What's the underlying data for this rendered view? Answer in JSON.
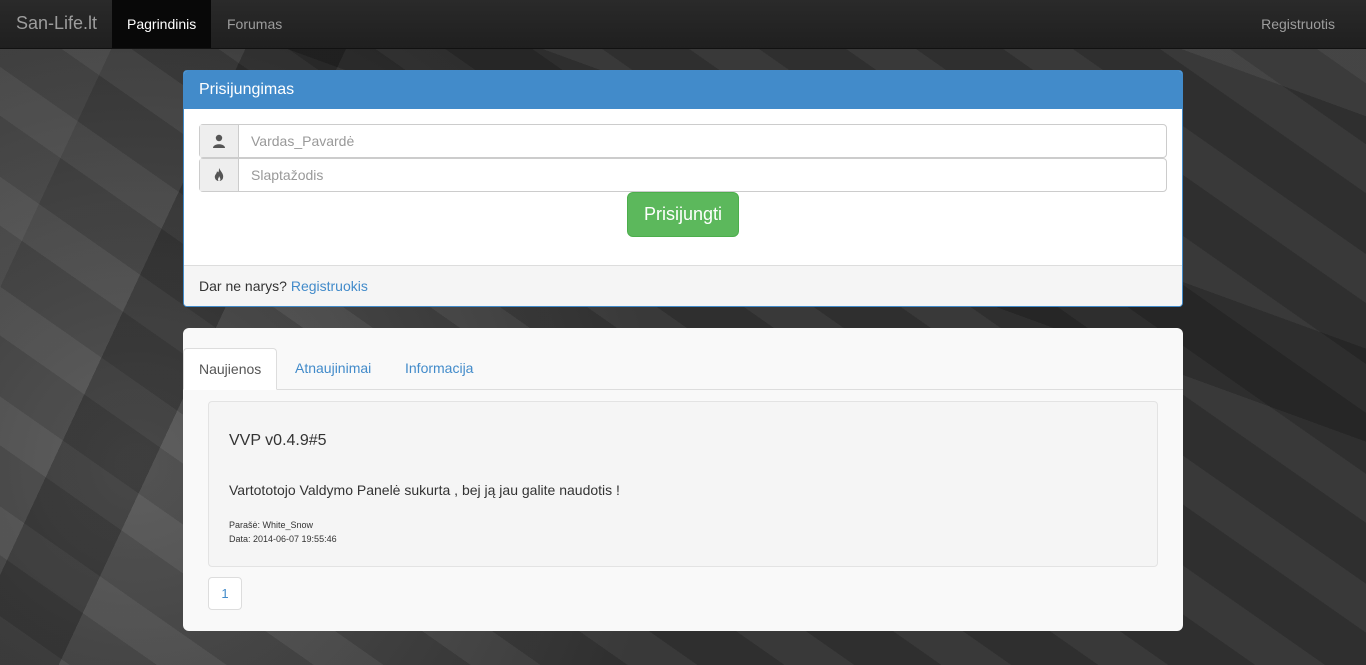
{
  "navbar": {
    "brand": "San-Life.lt",
    "items": [
      {
        "label": "Pagrindinis",
        "active": true
      },
      {
        "label": "Forumas",
        "active": false
      }
    ],
    "right_item": "Registruotis"
  },
  "login": {
    "title": "Prisijungimas",
    "username_placeholder": "Vardas_Pavardė",
    "password_placeholder": "Slaptažodis",
    "username_icon": "user-icon",
    "password_icon": "fire-icon",
    "submit_label": "Prisijungti",
    "footer_text": "Dar ne narys?",
    "footer_link": "Registruokis"
  },
  "news": {
    "tabs": [
      {
        "label": "Naujienos",
        "active": true
      },
      {
        "label": "Atnaujinimai",
        "active": false
      },
      {
        "label": "Informacija",
        "active": false
      }
    ],
    "post": {
      "title": "VVP v0.4.9#5",
      "body": "Vartototojo Valdymo Panelė sukurta , bej ją jau galite naudotis !",
      "author_line": "Parašė: White_Snow",
      "date_line": "Data: 2014-06-07 19:55:46"
    },
    "pagination": [
      "1"
    ]
  },
  "colors": {
    "primary": "#428bca",
    "success": "#5cb85c",
    "navbar": "#222222"
  }
}
